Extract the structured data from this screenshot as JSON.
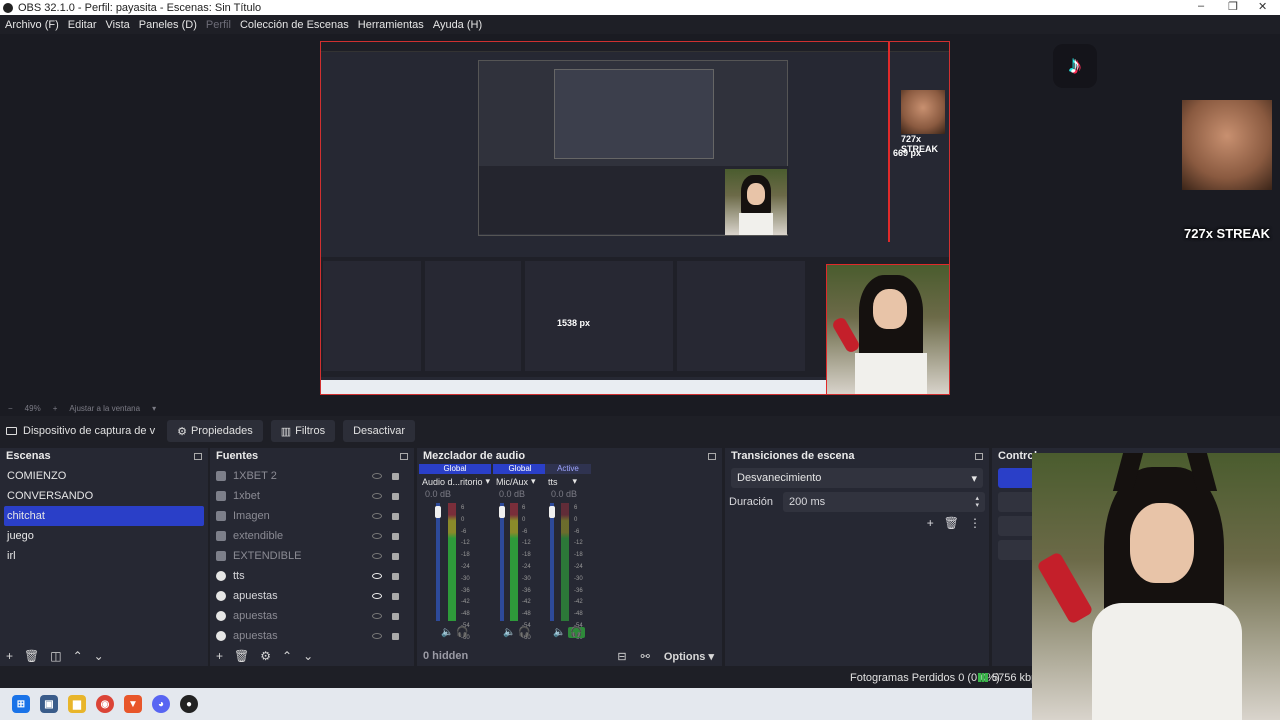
{
  "window": {
    "title": "OBS 32.1.0 - Perfil: payasita - Escenas: Sin Título",
    "controls": [
      "–",
      "❐",
      "✕"
    ]
  },
  "menu": [
    {
      "label": "Archivo (F)",
      "enabled": true
    },
    {
      "label": "Editar",
      "enabled": true
    },
    {
      "label": "Vista",
      "enabled": true
    },
    {
      "label": "Paneles (D)",
      "enabled": true
    },
    {
      "label": "Perfil",
      "enabled": false
    },
    {
      "label": "Colección de Escenas",
      "enabled": true
    },
    {
      "label": "Herramientas",
      "enabled": true
    },
    {
      "label": "Ayuda (H)",
      "enabled": true
    }
  ],
  "preview": {
    "overlay_streak": "727x STREAK",
    "inner_streak": "727x STREAK",
    "inner_px_v": "669 px",
    "inner_px_h": "1538 px",
    "tiktok_glyph": "♪"
  },
  "zoom": {
    "level": "49%",
    "fit": "Ajustar a la ventana"
  },
  "source_toolbar": {
    "source_name": "Dispositivo de captura de v",
    "properties": "Propiedades",
    "filters": "Filtros",
    "deactivate": "Desactivar"
  },
  "scenes": {
    "title": "Escenas",
    "items": [
      {
        "label": "COMIENZO",
        "selected": false
      },
      {
        "label": "CONVERSANDO",
        "selected": false
      },
      {
        "label": "chitchat",
        "selected": true
      },
      {
        "label": "juego",
        "selected": false
      },
      {
        "label": "irl",
        "selected": false
      }
    ]
  },
  "sources": {
    "title": "Fuentes",
    "items": [
      {
        "label": "1XBET 2",
        "visible": false,
        "icon": "image-icon"
      },
      {
        "label": "1xbet",
        "visible": false,
        "icon": "image-icon"
      },
      {
        "label": "Imagen",
        "visible": false,
        "icon": "image-icon"
      },
      {
        "label": "extendible",
        "visible": false,
        "icon": "image-icon"
      },
      {
        "label": "EXTENDIBLE",
        "visible": false,
        "icon": "image-icon"
      },
      {
        "label": "tts",
        "visible": true,
        "icon": "browser-icon"
      },
      {
        "label": "apuestas",
        "visible": true,
        "icon": "browser-icon"
      },
      {
        "label": "apuestas",
        "visible": false,
        "icon": "browser-icon"
      },
      {
        "label": "apuestas",
        "visible": false,
        "icon": "browser-icon"
      }
    ]
  },
  "mixer": {
    "title": "Mezclador de audio",
    "hidden_label": "0 hidden",
    "options_label": "Options",
    "ticks": [
      "6",
      "0",
      "-6",
      "-12",
      "-18",
      "-24",
      "-30",
      "-36",
      "-42",
      "-48",
      "-54",
      "-60"
    ],
    "channels": [
      {
        "tag": "Global",
        "name": "Audio d...ritorio",
        "db": "0.0 dB",
        "monitor_active": false
      },
      {
        "tag": "Global",
        "name": "Mic/Aux",
        "db": "0.0 dB",
        "monitor_active": false
      },
      {
        "tag": "Active",
        "name": "tts",
        "db": "0.0 dB",
        "monitor_active": true
      }
    ]
  },
  "transitions": {
    "title": "Transiciones de escena",
    "selected": "Desvanecimiento",
    "duration_label": "Duración",
    "duration_value": "200 ms"
  },
  "controls": {
    "title": "Controles"
  },
  "status": {
    "dropped": "Fotogramas Perdidos 0 (0.0%)",
    "bitrate": "5756 kbps"
  },
  "taskbar": [
    {
      "name": "windows-start-icon",
      "color": "#1a73e8",
      "glyph": "⊞"
    },
    {
      "name": "task-view-icon",
      "color": "#3a5c8a",
      "glyph": "▣"
    },
    {
      "name": "file-explorer-icon",
      "color": "#e8b52a",
      "glyph": "▆"
    },
    {
      "name": "chrome-icon",
      "color": "#db4437",
      "glyph": "◉"
    },
    {
      "name": "brave-icon",
      "color": "#e8562a",
      "glyph": "▼"
    },
    {
      "name": "discord-icon",
      "color": "#5865f2",
      "glyph": "◕"
    },
    {
      "name": "obs-icon",
      "color": "#222222",
      "glyph": "●"
    }
  ]
}
